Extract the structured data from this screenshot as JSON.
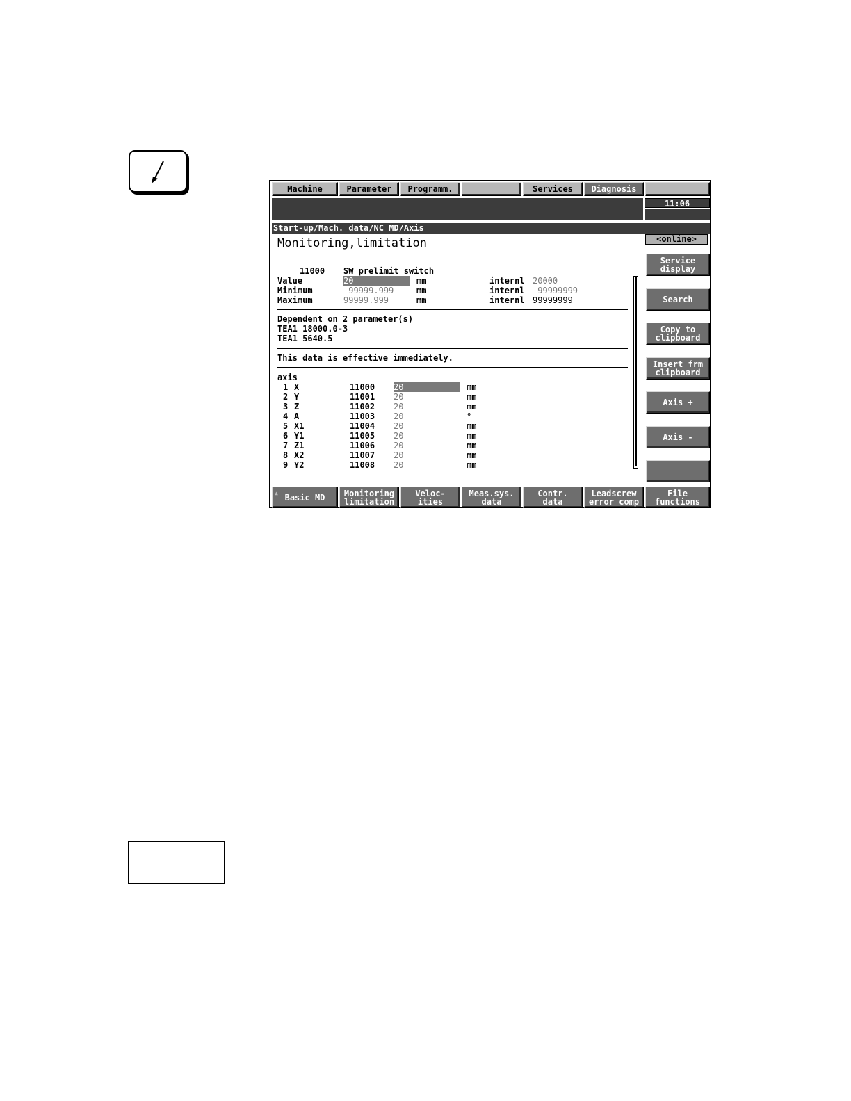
{
  "menu": [
    {
      "label": "Machine",
      "active": false
    },
    {
      "label": "Parameter",
      "active": false
    },
    {
      "label": "Programm.",
      "active": false
    },
    {
      "label": "",
      "active": false
    },
    {
      "label": "Services",
      "active": false
    },
    {
      "label": "Diagnosis",
      "active": true
    },
    {
      "label": "",
      "active": false
    }
  ],
  "clock": "11:06",
  "breadcrumb": "Start-up/Mach. data/NC MD/Axis",
  "title": "Monitoring,limitation",
  "status": "<online>",
  "param": {
    "number": "11000",
    "name": "SW prelimit switch",
    "value_label": "Value",
    "value": "20",
    "value_unit": "mm",
    "min_label": "Minimum",
    "min": "-99999.999",
    "min_unit": "mm",
    "max_label": "Maximum",
    "max": "99999.999",
    "max_unit": "mm",
    "internl_label": "internl",
    "internl_value": "20000",
    "internl_min": "-99999999",
    "internl_max": "99999999"
  },
  "dependency": {
    "heading": "Dependent on 2 parameter(s)",
    "items": [
      "TEA1 18000.0-3",
      "TEA1 5640.5"
    ]
  },
  "effective": "This data is effective immediately.",
  "axis_heading": "axis",
  "axes": [
    {
      "idx": "1",
      "name": "X",
      "md": "11000",
      "value": "20",
      "unit": "mm"
    },
    {
      "idx": "2",
      "name": "Y",
      "md": "11001",
      "value": "20",
      "unit": "mm"
    },
    {
      "idx": "3",
      "name": "Z",
      "md": "11002",
      "value": "20",
      "unit": "mm"
    },
    {
      "idx": "4",
      "name": "A",
      "md": "11003",
      "value": "20",
      "unit": "°"
    },
    {
      "idx": "5",
      "name": "X1",
      "md": "11004",
      "value": "20",
      "unit": "mm"
    },
    {
      "idx": "6",
      "name": "Y1",
      "md": "11005",
      "value": "20",
      "unit": "mm"
    },
    {
      "idx": "7",
      "name": "Z1",
      "md": "11006",
      "value": "20",
      "unit": "mm"
    },
    {
      "idx": "8",
      "name": "X2",
      "md": "11007",
      "value": "20",
      "unit": "mm"
    },
    {
      "idx": "9",
      "name": "Y2",
      "md": "11008",
      "value": "20",
      "unit": "mm"
    }
  ],
  "vertical_softkeys": [
    "Service\ndisplay",
    "Search",
    "Copy to\nclipboard",
    "Insert frm\nclipboard",
    "Axis +",
    "Axis -",
    ""
  ],
  "horizontal_softkeys": [
    "Basic MD",
    "Monitoring\nlimitation",
    "Veloc-\nities",
    "Meas.sys.\ndata",
    "Contr.\ndata",
    "Leadscrew\nerror comp",
    "File\nfunctions"
  ],
  "colors": {
    "key_gray": "#6e6e6e",
    "menu_gray": "#b7b7b7",
    "header_dark": "#3c3c3c",
    "value_gray": "#7a7a7a"
  }
}
